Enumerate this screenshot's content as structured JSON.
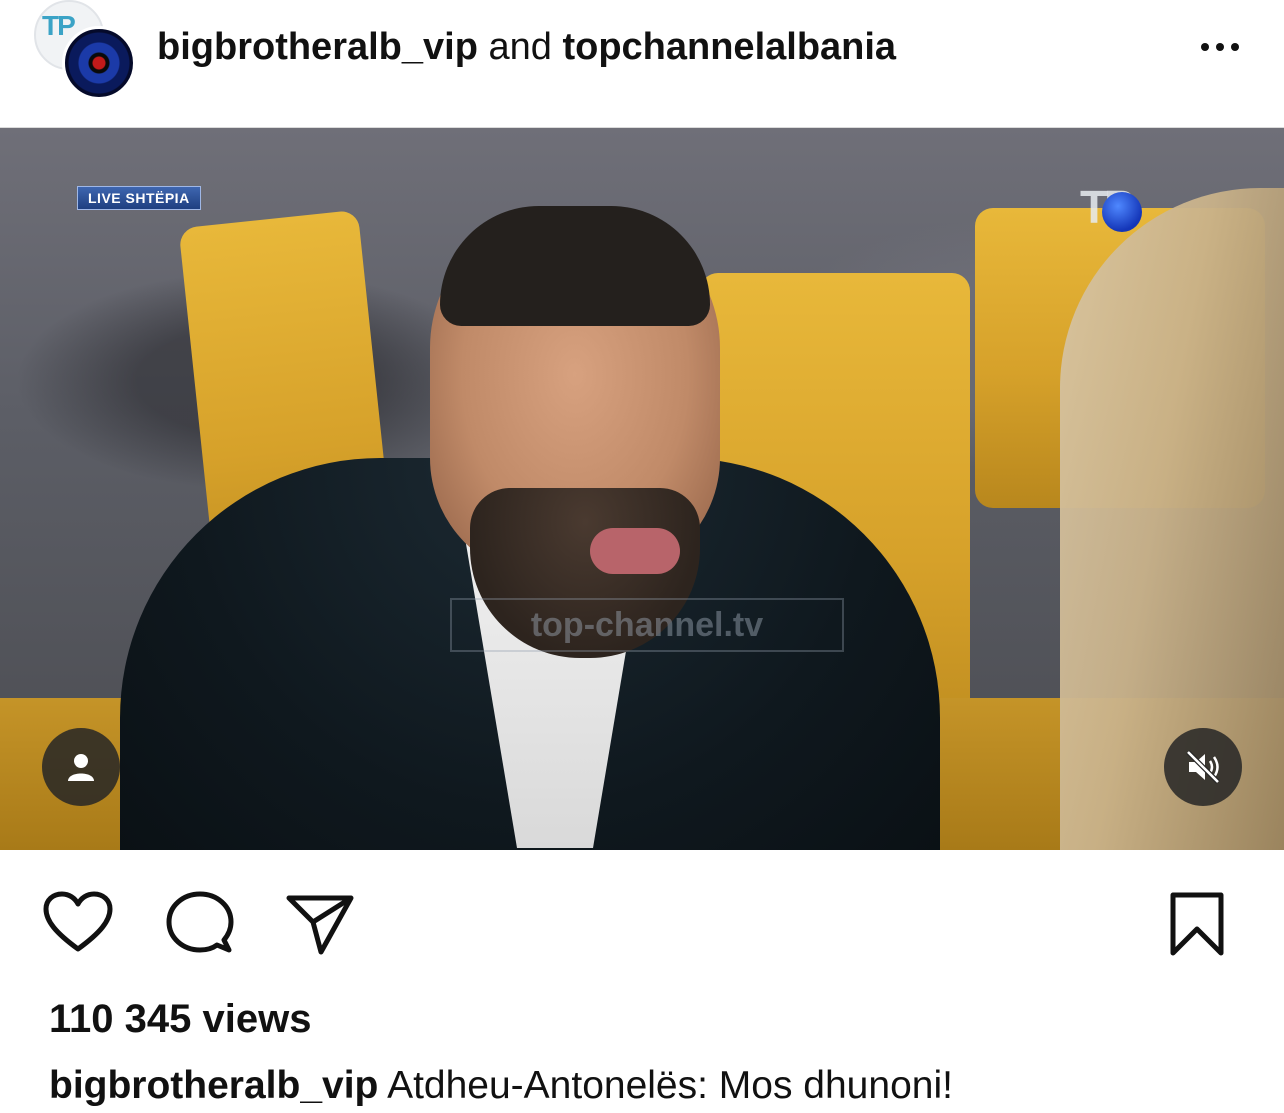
{
  "header": {
    "author_primary": "bigbrotheralb_vip",
    "author_joiner": "and",
    "author_secondary": "topchannelalbania",
    "avatar_back_mark": "TP",
    "more_icon": "more-horizontal-icon"
  },
  "video": {
    "live_badge": "LIVE SHTËPIA",
    "channel_logo": "TP",
    "watermark_text": "top-channel.tv",
    "tag_icon": "person-tag-icon",
    "mute_icon": "speaker-muted-icon"
  },
  "actions": {
    "like_icon": "heart-icon",
    "comment_icon": "comment-icon",
    "share_icon": "send-icon",
    "save_icon": "bookmark-icon"
  },
  "stats": {
    "views": "110 345 views"
  },
  "caption": {
    "username": "bigbrotheralb_vip",
    "text": "Atdheu-Antonelës: Mos dhunoni!"
  },
  "colors": {
    "text": "#111111",
    "divider": "#dbdbdb",
    "chair_yellow": "#d6a12a",
    "overlay_button": "#262626"
  }
}
